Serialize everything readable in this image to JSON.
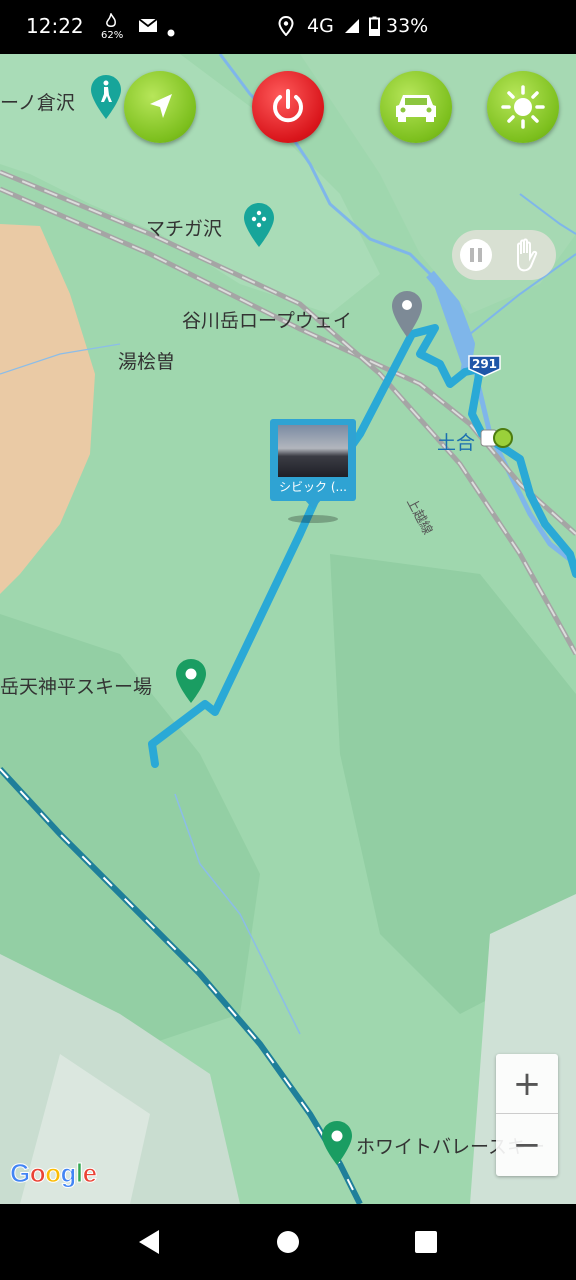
{
  "status_bar": {
    "time": "12:22",
    "small_indicator": "62%",
    "network": "4G",
    "battery": "33%",
    "icons": [
      "fire-icon",
      "mail-icon",
      "dot-icon",
      "location-icon",
      "signal-icon",
      "battery-icon"
    ]
  },
  "toolbar": {
    "buttons": [
      {
        "name": "navigate-button",
        "icon": "compass-arrow-icon",
        "color": "#7cbf1d"
      },
      {
        "name": "power-button",
        "icon": "power-icon",
        "color": "#d9151b"
      },
      {
        "name": "car-button",
        "icon": "car-icon",
        "color": "#7cbf1d"
      },
      {
        "name": "brightness-button",
        "icon": "sun-icon",
        "color": "#7cbf1d"
      }
    ]
  },
  "map": {
    "labels": {
      "kuratsuzawa": "ーノ倉沢",
      "machigazawa": "マチガ沢",
      "ropeway": "谷川岳ロープウェイ",
      "yunokiso": "湯桧曽",
      "doai": "土合",
      "route": "291",
      "rail_line": "上越線",
      "ski_tenjin": "岳天神平スキー場",
      "ski_white": "ホワイトバレースキー"
    },
    "photo_caption": "シビック (...",
    "colors": {
      "track": "#2aa9d6",
      "river": "#7fb6ea",
      "railway": "#9c9c9c",
      "highway": "#1f7f9a",
      "terrain": "#9fd7ae",
      "bare": "#f2c9a4"
    }
  },
  "zoom": {
    "in_label": "+",
    "out_label": "−"
  },
  "google_logo": {
    "letters": [
      {
        "ch": "G",
        "color": "#4285f4"
      },
      {
        "ch": "o",
        "color": "#ea4335"
      },
      {
        "ch": "o",
        "color": "#fbbc05"
      },
      {
        "ch": "g",
        "color": "#4285f4"
      },
      {
        "ch": "l",
        "color": "#34a853"
      },
      {
        "ch": "e",
        "color": "#ea4335"
      }
    ]
  },
  "nav_bar": {
    "buttons": [
      "back-button",
      "home-button",
      "recents-button"
    ]
  }
}
